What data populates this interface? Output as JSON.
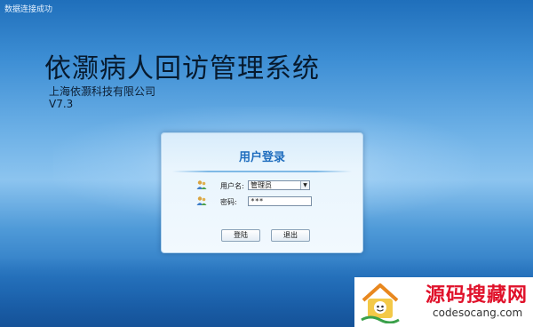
{
  "status": {
    "text": "数据连接成功"
  },
  "app": {
    "title": "依灏病人回访管理系统",
    "company": "上海依灏科技有限公司",
    "version": "V7.3"
  },
  "login": {
    "title": "用户登录",
    "username_label": "用户名:",
    "username_value": "管理员",
    "password_label": "密码:",
    "password_value": "***",
    "login_button": "登陆",
    "exit_button": "退出"
  },
  "watermark": {
    "text": "源码搜藏网",
    "url": "codesocang.com"
  },
  "colors": {
    "login_title": "#1f6dbe",
    "watermark_text": "#e0112a"
  }
}
